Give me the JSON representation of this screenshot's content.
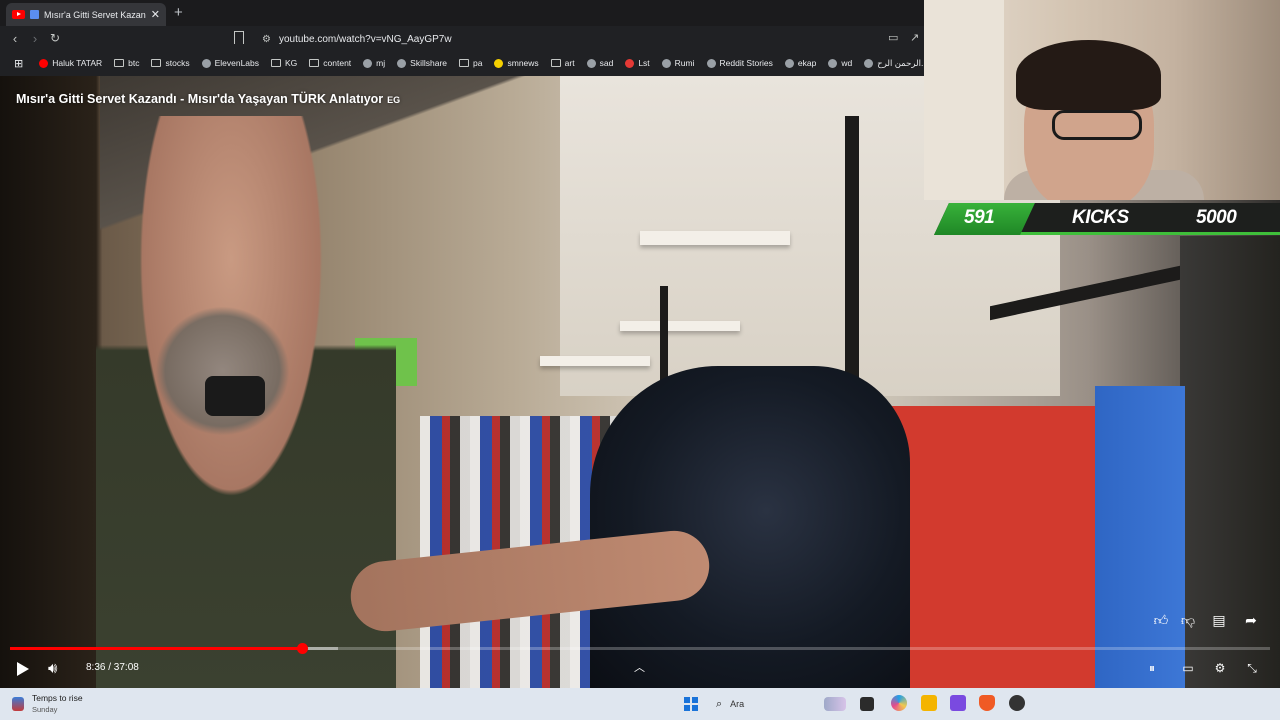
{
  "browser": {
    "tab_title": "Mısır'a Gitti Servet Kazandı - M",
    "tab_close": "✕",
    "new_tab": "+",
    "url": "youtube.com/watch?v=vNG_AayGP7w",
    "bookmarks": [
      {
        "label": "Haluk TATAR",
        "icon": "youtube-icon",
        "color": "#ff0000"
      },
      {
        "label": "btc",
        "icon": "folder-icon"
      },
      {
        "label": "stocks",
        "icon": "folder-icon"
      },
      {
        "label": "ElevenLabs",
        "icon": "elevenlabs-icon"
      },
      {
        "label": "KG",
        "icon": "folder-icon"
      },
      {
        "label": "content",
        "icon": "folder-icon"
      },
      {
        "label": "mj",
        "icon": "github-icon"
      },
      {
        "label": "Skillshare",
        "icon": "skillshare-icon"
      },
      {
        "label": "pa",
        "icon": "folder-icon"
      },
      {
        "label": "smnews",
        "icon": "smiley-icon",
        "color": "#f5d000"
      },
      {
        "label": "art",
        "icon": "folder-icon"
      },
      {
        "label": "sad",
        "icon": "slash-icon"
      },
      {
        "label": "Lst",
        "icon": "s-logo-icon",
        "color": "#e53935"
      },
      {
        "label": "Rumi",
        "icon": "globe-icon"
      },
      {
        "label": "Reddit Stories",
        "icon": "d-logo-icon"
      },
      {
        "label": "ekap",
        "icon": "bird-icon"
      },
      {
        "label": "wd",
        "icon": "w-logo-icon"
      },
      {
        "label": "الرحمن الرح...",
        "icon": "book-icon"
      }
    ]
  },
  "video": {
    "title": "Mısır'a Gitti Servet Kazandı - Mısır'da Yaşayan TÜRK Anlatıyor",
    "title_suffix": "EG",
    "time": "8:36 / 37:08",
    "progress_fraction": 0.232,
    "buffered_fraction": 0.26
  },
  "stream_overlay": {
    "left_value": "591",
    "center_label": "KICKS",
    "right_value": "5000"
  },
  "taskbar": {
    "weather_title": "Temps to rise",
    "weather_subtitle": "Sunday",
    "search_label": "Ara"
  },
  "colors": {
    "accent_red": "#ff0000",
    "overlay_green": "#38b23a",
    "taskbar_bg": "#dfe6ef"
  }
}
